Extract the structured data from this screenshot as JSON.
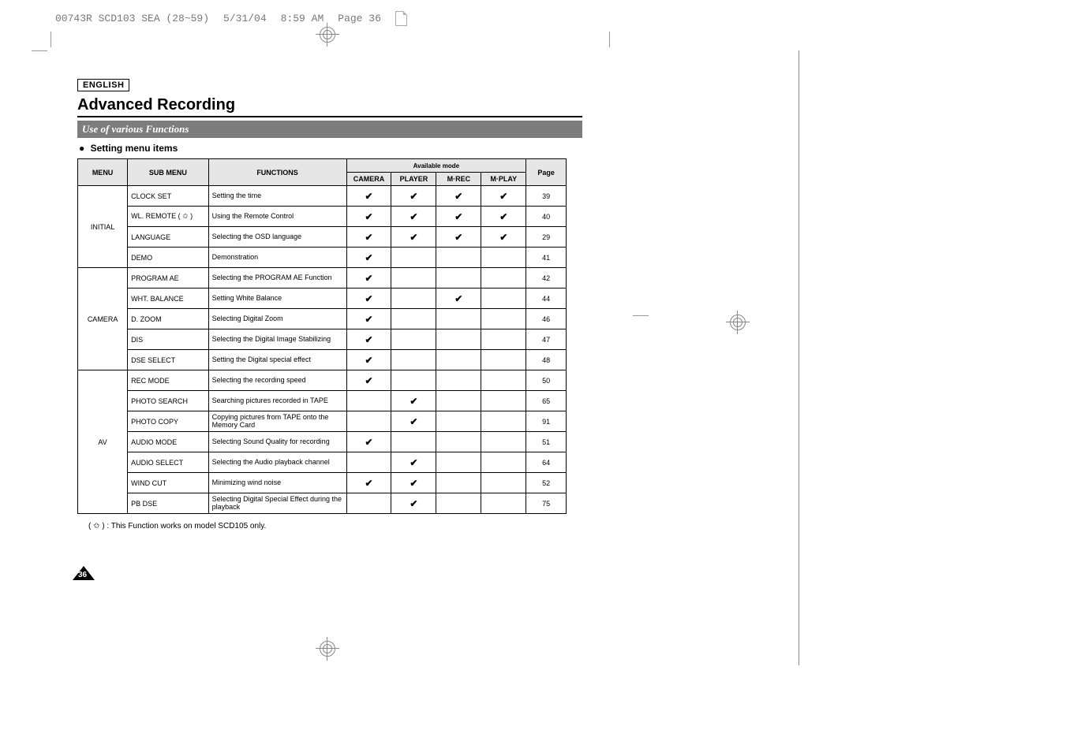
{
  "header_file": {
    "filename": "00743R SCD103 SEA (28~59)",
    "date": "5/31/04",
    "time": "8:59 AM",
    "page_label": "Page 36"
  },
  "language_label": "ENGLISH",
  "main_title": "Advanced Recording",
  "section_bar": "Use of various Functions",
  "setting_label": "Setting menu items",
  "page_badge": "36",
  "table": {
    "headers": {
      "menu": "MENU",
      "sub_menu": "SUB MENU",
      "functions": "FUNCTIONS",
      "available_mode": "Available mode",
      "camera": "CAMERA",
      "player": "PLAYER",
      "mrec": "M·REC",
      "mplay": "M·PLAY",
      "page": "Page"
    },
    "groups": [
      {
        "menu": "INITIAL",
        "rows": [
          {
            "sub": "CLOCK SET",
            "func": "Setting the time",
            "camera": true,
            "player": true,
            "mrec": true,
            "mplay": true,
            "page": "39"
          },
          {
            "sub": "WL. REMOTE ( ✩ )",
            "func": "Using the Remote Control",
            "camera": true,
            "player": true,
            "mrec": true,
            "mplay": true,
            "page": "40"
          },
          {
            "sub": "LANGUAGE",
            "func": "Selecting the OSD language",
            "camera": true,
            "player": true,
            "mrec": true,
            "mplay": true,
            "page": "29"
          },
          {
            "sub": "DEMO",
            "func": "Demonstration",
            "camera": true,
            "player": false,
            "mrec": false,
            "mplay": false,
            "page": "41"
          }
        ]
      },
      {
        "menu": "CAMERA",
        "rows": [
          {
            "sub": "PROGRAM AE",
            "func": "Selecting the PROGRAM AE Function",
            "camera": true,
            "player": false,
            "mrec": false,
            "mplay": false,
            "page": "42"
          },
          {
            "sub": "WHT. BALANCE",
            "func": "Setting White Balance",
            "camera": true,
            "player": false,
            "mrec": true,
            "mplay": false,
            "page": "44"
          },
          {
            "sub": "D. ZOOM",
            "func": "Selecting Digital Zoom",
            "camera": true,
            "player": false,
            "mrec": false,
            "mplay": false,
            "page": "46"
          },
          {
            "sub": "DIS",
            "func": "Selecting the Digital Image Stabilizing",
            "camera": true,
            "player": false,
            "mrec": false,
            "mplay": false,
            "page": "47"
          },
          {
            "sub": "DSE SELECT",
            "func": "Setting the Digital special effect",
            "camera": true,
            "player": false,
            "mrec": false,
            "mplay": false,
            "page": "48"
          }
        ]
      },
      {
        "menu": "AV",
        "rows": [
          {
            "sub": "REC MODE",
            "func": "Selecting the recording speed",
            "camera": true,
            "player": false,
            "mrec": false,
            "mplay": false,
            "page": "50"
          },
          {
            "sub": "PHOTO SEARCH",
            "func": "Searching pictures recorded in TAPE",
            "camera": false,
            "player": true,
            "mrec": false,
            "mplay": false,
            "page": "65"
          },
          {
            "sub": "PHOTO COPY",
            "func": "Copying pictures from TAPE onto the Memory Card",
            "camera": false,
            "player": true,
            "mrec": false,
            "mplay": false,
            "page": "91"
          },
          {
            "sub": "AUDIO MODE",
            "func": "Selecting Sound Quality for recording",
            "camera": true,
            "player": false,
            "mrec": false,
            "mplay": false,
            "page": "51"
          },
          {
            "sub": "AUDIO SELECT",
            "func": "Selecting the Audio playback channel",
            "camera": false,
            "player": true,
            "mrec": false,
            "mplay": false,
            "page": "64"
          },
          {
            "sub": "WIND CUT",
            "func": "Minimizing wind noise",
            "camera": true,
            "player": true,
            "mrec": false,
            "mplay": false,
            "page": "52"
          },
          {
            "sub": "PB DSE",
            "func": "Selecting Digital Special Effect during the playback",
            "camera": false,
            "player": true,
            "mrec": false,
            "mplay": false,
            "page": "75"
          }
        ]
      }
    ]
  },
  "footnote": "( ✩ )  : This Function works on model SCD105 only."
}
